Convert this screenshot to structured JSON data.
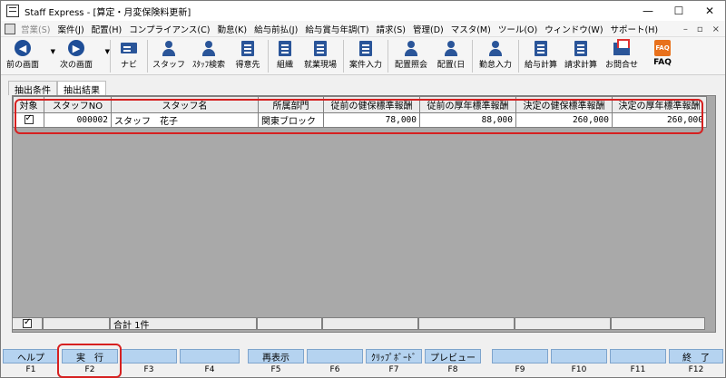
{
  "window": {
    "title": "Staff Express - [算定・月変保険料更新]",
    "controls": [
      "—",
      "☐",
      "✕"
    ]
  },
  "menubar": {
    "items": [
      {
        "label": "営業(S)",
        "disabled": true
      },
      {
        "label": "案件(J)",
        "disabled": false
      },
      {
        "label": "配置(H)",
        "disabled": false
      },
      {
        "label": "コンプライアンス(C)",
        "disabled": false
      },
      {
        "label": "勤怠(K)",
        "disabled": false
      },
      {
        "label": "給与前払(J)",
        "disabled": false
      },
      {
        "label": "給与賞与年調(T)",
        "disabled": false
      },
      {
        "label": "請求(S)",
        "disabled": false
      },
      {
        "label": "管理(D)",
        "disabled": false
      },
      {
        "label": "マスタ(M)",
        "disabled": false
      },
      {
        "label": "ツール(O)",
        "disabled": false
      },
      {
        "label": "ウィンドウ(W)",
        "disabled": false
      },
      {
        "label": "サポート(H)",
        "disabled": false
      }
    ],
    "mdi_controls": [
      "–",
      "▫",
      "×"
    ]
  },
  "toolbar": {
    "items": [
      {
        "label": "前の画面",
        "icon": "back-arrow-icon"
      },
      {
        "label": "次の画面",
        "icon": "forward-arrow-icon"
      },
      {
        "label": "ナビ",
        "icon": "navi-icon"
      },
      {
        "label": "スタッフ",
        "icon": "staff-icon"
      },
      {
        "label": "ｽﾀｯﾌ検索",
        "icon": "staff-search-icon"
      },
      {
        "label": "得意先",
        "icon": "customer-icon"
      },
      {
        "label": "組織",
        "icon": "organization-icon"
      },
      {
        "label": "就業現場",
        "icon": "worksite-icon"
      },
      {
        "label": "案件入力",
        "icon": "job-entry-icon"
      },
      {
        "label": "配置照会",
        "icon": "placement-inquiry-icon"
      },
      {
        "label": "配置(日",
        "icon": "placement-daily-icon"
      },
      {
        "label": "勤怠入力",
        "icon": "attendance-entry-icon"
      },
      {
        "label": "給与計算",
        "icon": "payroll-calc-icon"
      },
      {
        "label": "請求計算",
        "icon": "billing-calc-icon"
      },
      {
        "label": "お問合せ",
        "icon": "inquiry-mail-icon"
      },
      {
        "label": "FAQ",
        "icon": "faq-icon"
      }
    ]
  },
  "tabs": [
    "抽出条件",
    "抽出結果"
  ],
  "grid": {
    "headers": [
      "対象",
      "スタッフNO",
      "スタッフ名",
      "所属部門",
      "従前の健保標準報酬",
      "従前の厚年標準報酬",
      "決定の健保標準報酬",
      "決定の厚年標準報酬"
    ],
    "rows": [
      {
        "checked": true,
        "staff_no": "000002",
        "staff_name": "スタッフ　花子",
        "department": "関東ブロック",
        "prev_health": "78,000",
        "prev_pension": "88,000",
        "new_health": "260,000",
        "new_pension": "260,000"
      }
    ],
    "footer_total": "合計 1件"
  },
  "fkeys": [
    {
      "label": "ヘルプ",
      "key": "F1"
    },
    {
      "label": "実　行",
      "key": "F2"
    },
    {
      "label": "",
      "key": "F3"
    },
    {
      "label": "",
      "key": "F4"
    },
    {
      "label": "再表示",
      "key": "F5"
    },
    {
      "label": "",
      "key": "F6"
    },
    {
      "label": "ｸﾘｯﾌﾟﾎﾞｰﾄﾞ",
      "key": "F7"
    },
    {
      "label": "プレビュー",
      "key": "F8"
    },
    {
      "label": "",
      "key": "F9"
    },
    {
      "label": "",
      "key": "F10"
    },
    {
      "label": "",
      "key": "F11"
    },
    {
      "label": "終　了",
      "key": "F12"
    }
  ],
  "colors": {
    "highlight": "#d62020",
    "fkey_bg": "#b5d3f0",
    "panel_bg": "#a9a9a9",
    "icon_blue": "#2a5599",
    "faq_orange": "#e8711c"
  }
}
